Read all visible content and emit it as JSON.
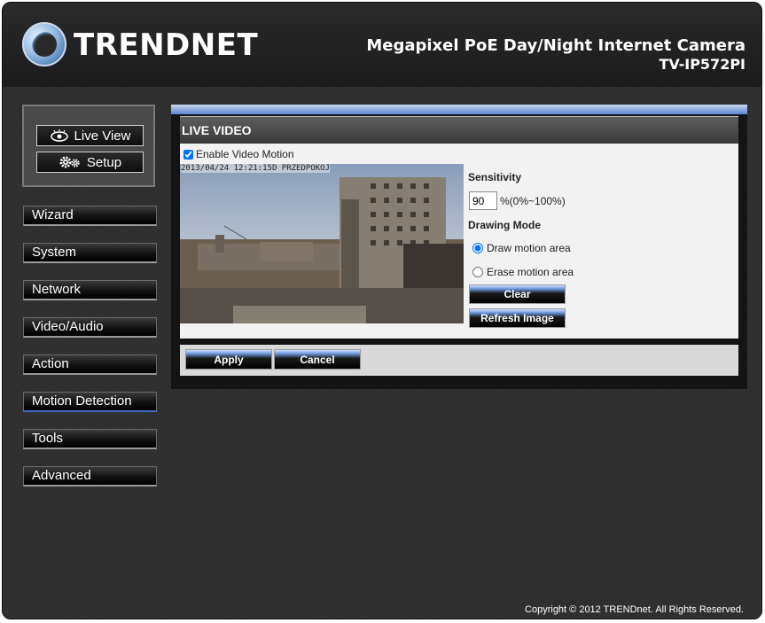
{
  "header": {
    "brand": "TRENDNET",
    "camera_title": "Megapixel PoE Day/Night Internet Camera",
    "camera_model": "TV-IP572PI"
  },
  "top_buttons": {
    "live_view": "Live View",
    "setup": "Setup"
  },
  "nav": {
    "items": [
      {
        "label": "Wizard"
      },
      {
        "label": "System"
      },
      {
        "label": "Network"
      },
      {
        "label": "Video/Audio"
      },
      {
        "label": "Action"
      },
      {
        "label": "Motion Detection",
        "active": true
      },
      {
        "label": "Tools"
      },
      {
        "label": "Advanced"
      }
    ]
  },
  "panel": {
    "title": "LIVE VIDEO",
    "enable_label": "Enable Video Motion",
    "enable_checked": true,
    "timestamp": "2013/04/24 12:21:15D PRZEDPOKOJ",
    "sensitivity_label": "Sensitivity",
    "sensitivity_value": "90",
    "sensitivity_range": "%(0%~100%)",
    "drawing_mode_label": "Drawing Mode",
    "draw_label": "Draw motion area",
    "erase_label": "Erase motion area",
    "clear_label": "Clear",
    "refresh_label": "Refresh Image",
    "apply_label": "Apply",
    "cancel_label": "Cancel"
  },
  "footer": {
    "copyright": "Copyright © 2012 TRENDnet. All Rights Reserved."
  },
  "colors": {
    "accent_blue": "#5c84cc",
    "background": "#2e2e2e"
  }
}
